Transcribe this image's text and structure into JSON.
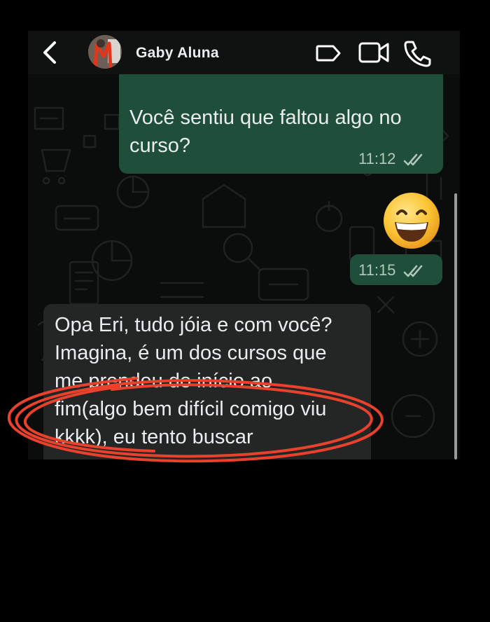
{
  "header": {
    "contact_name": "Gaby Aluna",
    "icons": [
      "back-chevron-icon",
      "label-tag-icon",
      "video-call-icon",
      "phone-call-icon"
    ]
  },
  "messages": [
    {
      "direction": "outgoing",
      "lines": [
        "Você sentiu que faltou algo no",
        "curso?"
      ],
      "time": "11:12",
      "status": "read"
    },
    {
      "direction": "outgoing",
      "emoji": "😄",
      "time": "11:15",
      "status": "read"
    },
    {
      "direction": "incoming",
      "lines": [
        "Opa Eri, tudo jóia e com você?",
        "Imagina, é um dos cursos que",
        "me prendeu do início ao",
        "fim(algo bem difícil comigo viu",
        "kkkk), eu tento buscar"
      ]
    }
  ],
  "colors": {
    "background": "#000000",
    "chat_background": "#0b0d0c",
    "header": "#101211",
    "outgoing_bubble": "#1f4f3b",
    "incoming_bubble": "#242626",
    "text": "#e9edef",
    "read_ticks": "#b0c9bc",
    "annotation": "#e8412c"
  },
  "annotation": {
    "type": "hand-drawn-circle",
    "color": "#e8412c"
  }
}
